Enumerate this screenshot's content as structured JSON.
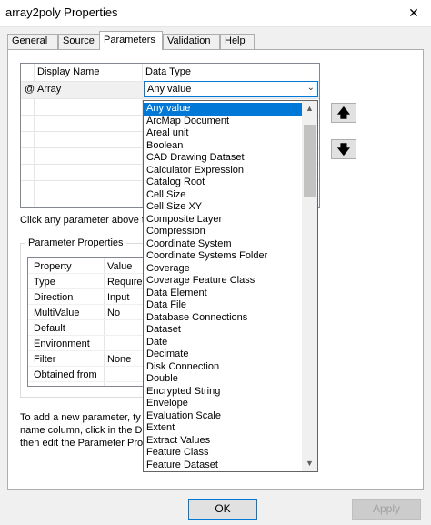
{
  "window": {
    "title": "array2poly Properties",
    "close_glyph": "✕"
  },
  "tabs": [
    {
      "label": "General"
    },
    {
      "label": "Source"
    },
    {
      "label": "Parameters",
      "active": true
    },
    {
      "label": "Validation"
    },
    {
      "label": "Help"
    }
  ],
  "grid": {
    "headers": {
      "name": "Display Name",
      "type": "Data Type"
    },
    "rows": [
      {
        "marker": "@",
        "name": "Array",
        "type": "Any value"
      }
    ]
  },
  "buttons": {
    "up_glyph": "🡅",
    "down_glyph": "🡇",
    "ok": "OK",
    "apply": "Apply"
  },
  "help_text": "Click any parameter above t",
  "param_props": {
    "title": "Parameter Properties",
    "headers": {
      "property": "Property",
      "value": "Value"
    },
    "rows": [
      {
        "k": "Type",
        "v": "Required"
      },
      {
        "k": "Direction",
        "v": "Input"
      },
      {
        "k": "MultiValue",
        "v": "No"
      },
      {
        "k": "Default",
        "v": ""
      },
      {
        "k": "Environment",
        "v": ""
      },
      {
        "k": "Filter",
        "v": "None"
      },
      {
        "k": "Obtained from",
        "v": ""
      }
    ]
  },
  "instructions": [
    "To add a new parameter, ty",
    "name column, click in the Da",
    "then edit the Parameter Prop"
  ],
  "dropdown": {
    "selected": "Any value",
    "items": [
      "Any value",
      "ArcMap Document",
      "Areal unit",
      "Boolean",
      "CAD Drawing Dataset",
      "Calculator Expression",
      "Catalog Root",
      "Cell Size",
      "Cell Size XY",
      "Composite Layer",
      "Compression",
      "Coordinate System",
      "Coordinate Systems Folder",
      "Coverage",
      "Coverage Feature Class",
      "Data Element",
      "Data File",
      "Database Connections",
      "Dataset",
      "Date",
      "Decimate",
      "Disk Connection",
      "Double",
      "Encrypted String",
      "Envelope",
      "Evaluation Scale",
      "Extent",
      "Extract Values",
      "Feature Class",
      "Feature Dataset"
    ]
  }
}
